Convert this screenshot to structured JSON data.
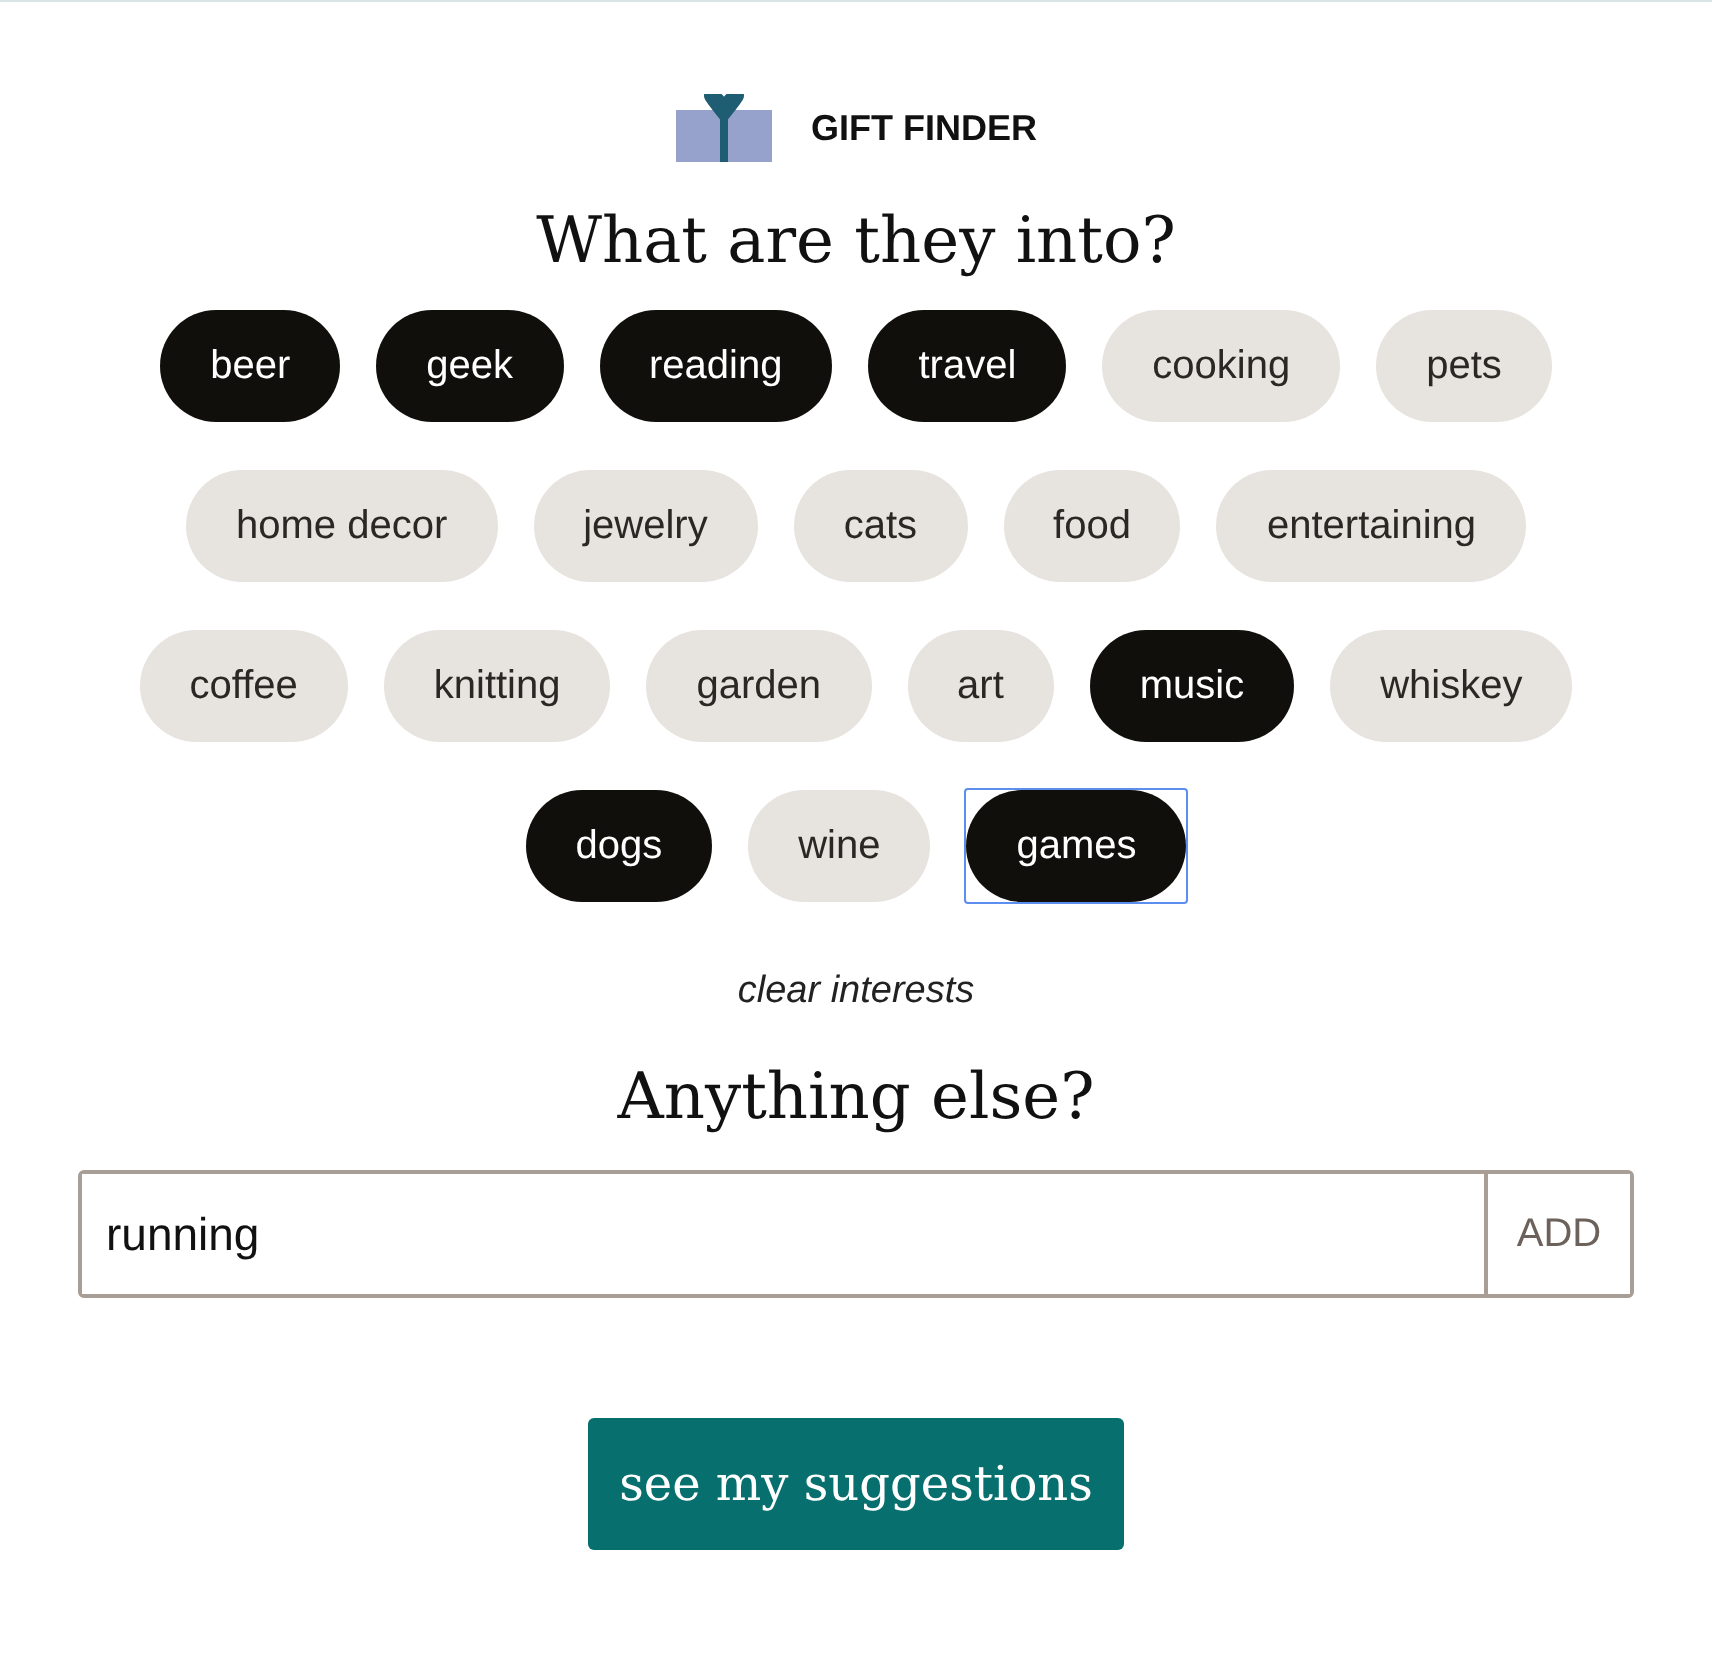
{
  "brand": {
    "title": "GIFT FINDER"
  },
  "interests_heading": "What are they into?",
  "interest_rows": [
    {
      "tags": [
        {
          "label": "beer",
          "selected": true,
          "focused": false
        },
        {
          "label": "geek",
          "selected": true,
          "focused": false
        },
        {
          "label": "reading",
          "selected": true,
          "focused": false
        },
        {
          "label": "travel",
          "selected": true,
          "focused": false
        },
        {
          "label": "cooking",
          "selected": false,
          "focused": false
        },
        {
          "label": "pets",
          "selected": false,
          "focused": false
        }
      ]
    },
    {
      "tags": [
        {
          "label": "home decor",
          "selected": false,
          "focused": false
        },
        {
          "label": "jewelry",
          "selected": false,
          "focused": false
        },
        {
          "label": "cats",
          "selected": false,
          "focused": false
        },
        {
          "label": "food",
          "selected": false,
          "focused": false
        },
        {
          "label": "entertaining",
          "selected": false,
          "focused": false
        }
      ]
    },
    {
      "tags": [
        {
          "label": "coffee",
          "selected": false,
          "focused": false
        },
        {
          "label": "knitting",
          "selected": false,
          "focused": false
        },
        {
          "label": "garden",
          "selected": false,
          "focused": false
        },
        {
          "label": "art",
          "selected": false,
          "focused": false
        },
        {
          "label": "music",
          "selected": true,
          "focused": false
        },
        {
          "label": "whiskey",
          "selected": false,
          "focused": false
        }
      ]
    },
    {
      "tags": [
        {
          "label": "dogs",
          "selected": true,
          "focused": false
        },
        {
          "label": "wine",
          "selected": false,
          "focused": false
        },
        {
          "label": "games",
          "selected": true,
          "focused": true
        }
      ]
    }
  ],
  "clear_link": "clear interests",
  "else_heading": "Anything else?",
  "extra_input": {
    "value": "running",
    "button": "ADD"
  },
  "submit_button": "see my suggestions"
}
